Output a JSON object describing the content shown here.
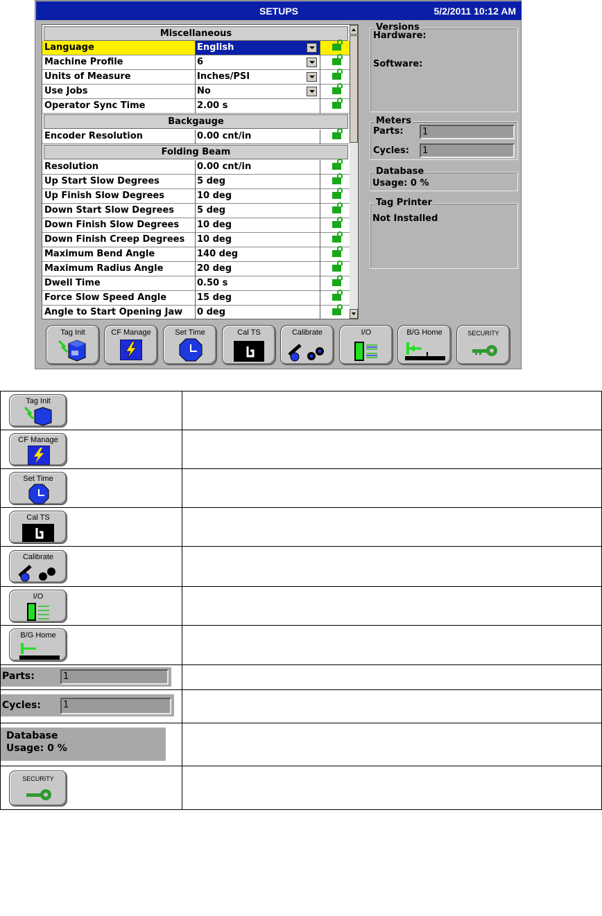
{
  "window": {
    "title": "SETUPS",
    "datetime": "5/2/2011  10:12 AM"
  },
  "grid": {
    "sections": [
      {
        "header": "Miscellaneous",
        "rows": [
          {
            "name": "Language",
            "value": "English",
            "selected": true,
            "dropdown": true
          },
          {
            "name": "Machine Profile",
            "value": "6",
            "dropdown": true
          },
          {
            "name": "Units of Measure",
            "value": "Inches/PSI",
            "dropdown": true
          },
          {
            "name": "Use Jobs",
            "value": "No",
            "dropdown": true
          },
          {
            "name": "Operator Sync Time",
            "value": "2.00 s"
          }
        ]
      },
      {
        "header": "Backgauge",
        "rows": [
          {
            "name": "Encoder Resolution",
            "value": "0.00 cnt/in"
          }
        ]
      },
      {
        "header": "Folding Beam",
        "rows": [
          {
            "name": "Resolution",
            "value": "0.00 cnt/in"
          },
          {
            "name": "Up Start Slow Degrees",
            "value": "5 deg"
          },
          {
            "name": "Up Finish Slow Degrees",
            "value": "10 deg"
          },
          {
            "name": "Down Start Slow Degrees",
            "value": "5 deg"
          },
          {
            "name": "Down Finish Slow Degrees",
            "value": "10 deg"
          },
          {
            "name": "Down Finish Creep Degrees",
            "value": "10 deg"
          },
          {
            "name": "Maximum Bend Angle",
            "value": "140 deg"
          },
          {
            "name": "Maximum Radius Angle",
            "value": "20 deg"
          },
          {
            "name": "Dwell Time",
            "value": "0.50 s"
          },
          {
            "name": "Force Slow Speed Angle",
            "value": "15 deg"
          },
          {
            "name": "Angle to Start Opening Jaw",
            "value": "0 deg"
          }
        ]
      }
    ]
  },
  "versions": {
    "legend": "Versions",
    "hardware_label": "Hardware:",
    "software_label": "Software:"
  },
  "meters": {
    "legend": "Meters",
    "parts_label": "Parts:",
    "parts_value": "1",
    "cycles_label": "Cycles:",
    "cycles_value": "1"
  },
  "database": {
    "legend": "Database",
    "usage": "Usage: 0 %"
  },
  "tag_printer": {
    "legend": "Tag Printer",
    "status": "Not Installed"
  },
  "toolbar": [
    {
      "label": "Tag Init",
      "icon": "tag-init-icon"
    },
    {
      "label": "CF Manage",
      "icon": "lightning-icon"
    },
    {
      "label": "Set Time",
      "icon": "clock-icon"
    },
    {
      "label": "Cal TS",
      "icon": "touch-hand-icon"
    },
    {
      "label": "Calibrate",
      "icon": "gears-icon"
    },
    {
      "label": "I/O",
      "icon": "io-arrows-icon"
    },
    {
      "label": "B/G Home",
      "icon": "backgauge-home-icon"
    },
    {
      "label": "SECURITY",
      "icon": "key-icon"
    }
  ],
  "legend_table": {
    "rows": [
      {
        "kind": "button",
        "label": "Tag Init",
        "icon": "tag-init-icon",
        "description": ""
      },
      {
        "kind": "button",
        "label": "CF Manage",
        "icon": "lightning-icon",
        "description": ""
      },
      {
        "kind": "button",
        "label": "Set Time",
        "icon": "clock-icon",
        "description": ""
      },
      {
        "kind": "button",
        "label": "Cal TS",
        "icon": "touch-hand-icon",
        "description": ""
      },
      {
        "kind": "button",
        "label": "Calibrate",
        "icon": "gears-icon",
        "description": ""
      },
      {
        "kind": "button",
        "label": "I/O",
        "icon": "io-arrows-icon",
        "description": ""
      },
      {
        "kind": "button",
        "label": "B/G Home",
        "icon": "backgauge-home-icon",
        "description": ""
      },
      {
        "kind": "field",
        "label": "Parts:",
        "value": "1",
        "description": ""
      },
      {
        "kind": "field",
        "label": "Cycles:",
        "value": "1",
        "description": ""
      },
      {
        "kind": "database",
        "legend": "Database",
        "usage": "Usage: 0 %",
        "description": ""
      },
      {
        "kind": "button",
        "label": "SECURITY",
        "icon": "key-icon",
        "description": ""
      }
    ]
  },
  "colors": {
    "title_blue": "#0a1fa8",
    "selected_yellow": "#fff000",
    "lock_green": "#18a818",
    "panel_gray": "#b5b5b5"
  }
}
